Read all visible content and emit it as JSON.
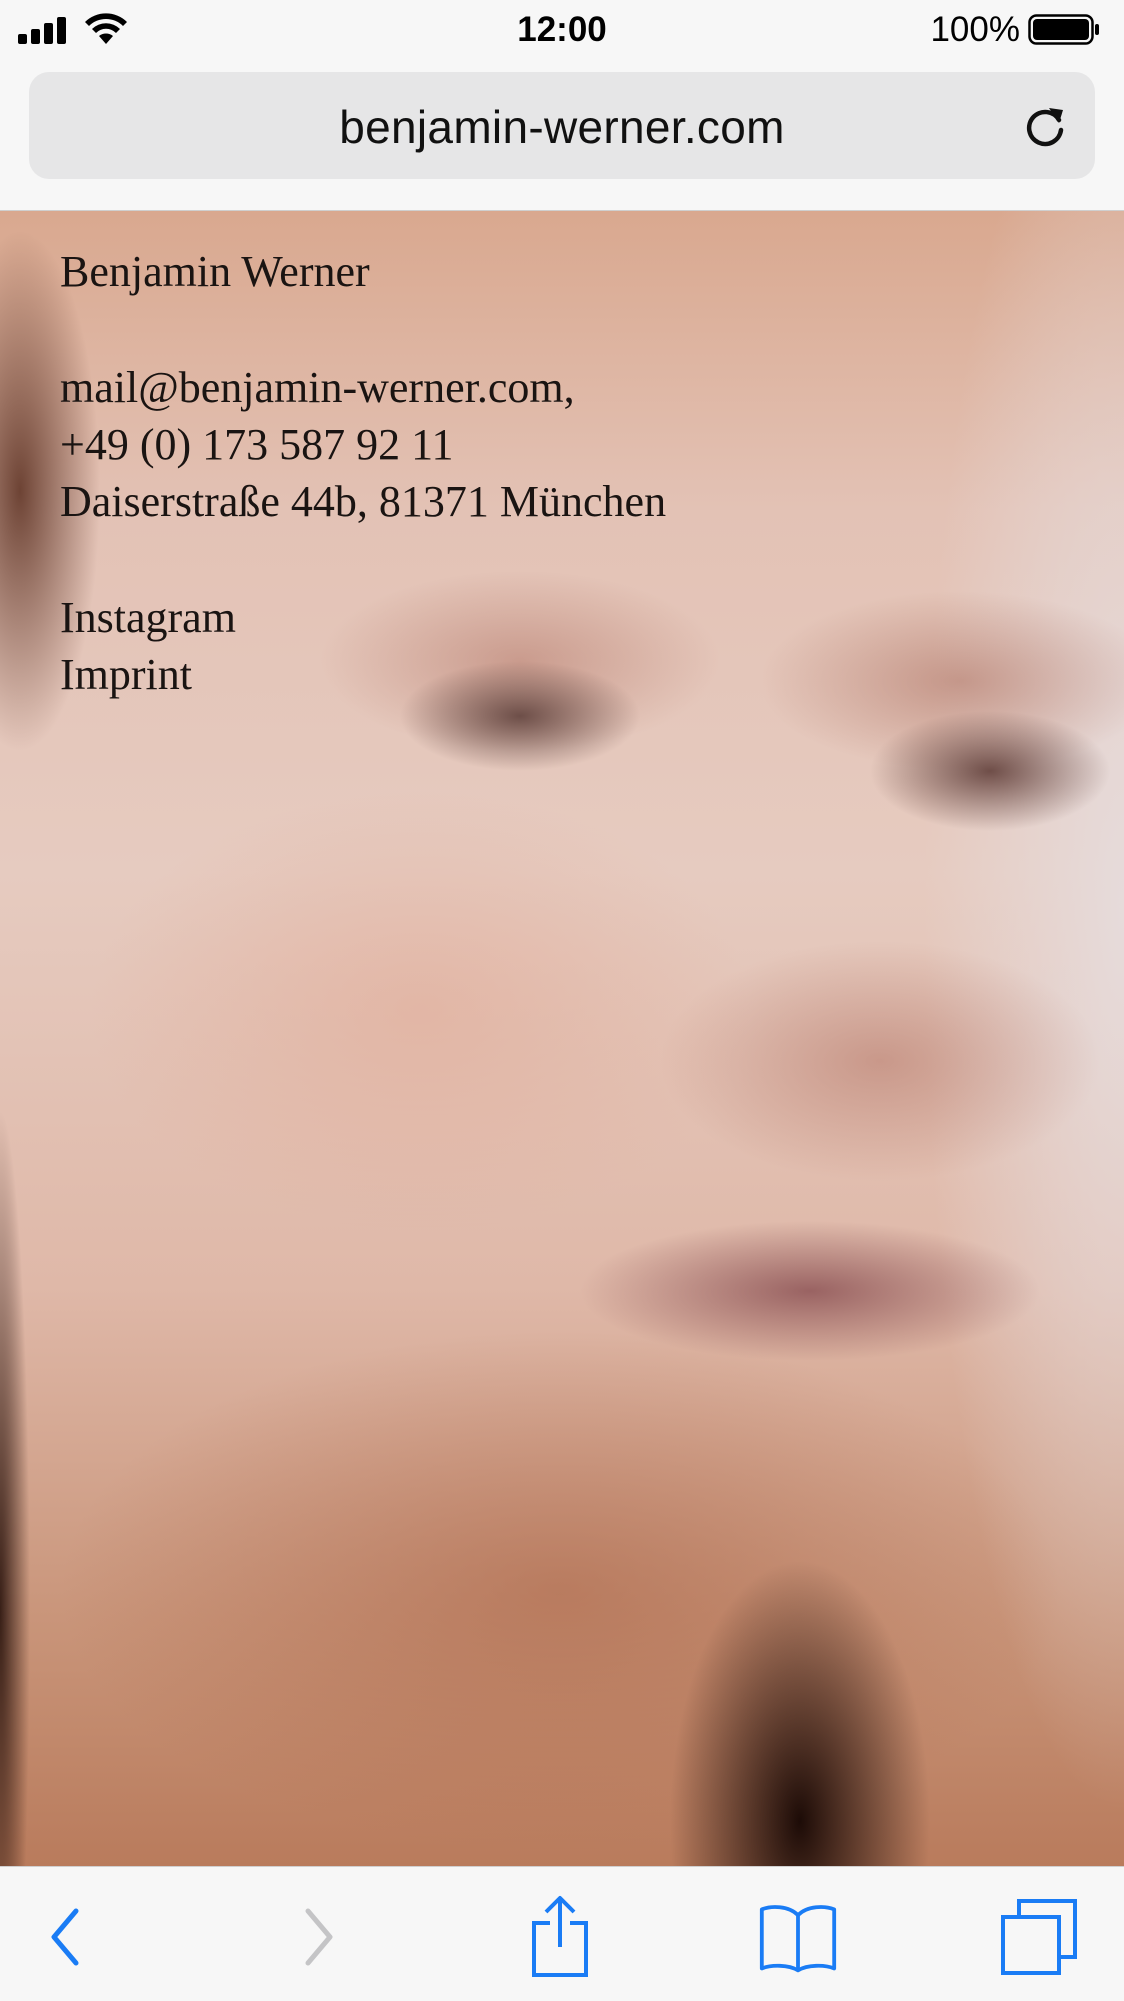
{
  "status_bar": {
    "time": "12:00",
    "battery_percent": "100%",
    "signal_icon": "cellular-signal-icon",
    "wifi_icon": "wifi-icon",
    "battery_icon": "battery-full-icon"
  },
  "address_bar": {
    "url": "benjamin-werner.com",
    "reload_icon": "reload-icon"
  },
  "page": {
    "name": "Benjamin Werner",
    "email": "mail@benjamin-werner.com,",
    "phone": "+49 (0) 173 587 92 11",
    "address": "Daiserstraße 44b, 81371 München",
    "links": [
      "Instagram",
      "Imprint"
    ]
  },
  "toolbar": {
    "back_icon": "back-chevron-icon",
    "forward_icon": "forward-chevron-icon",
    "share_icon": "share-icon",
    "bookmarks_icon": "bookmarks-book-icon",
    "tabs_icon": "tabs-icon"
  },
  "colors": {
    "accent": "#1a7cf5",
    "disabled": "#c4c4c6",
    "text": "#1a1412"
  }
}
